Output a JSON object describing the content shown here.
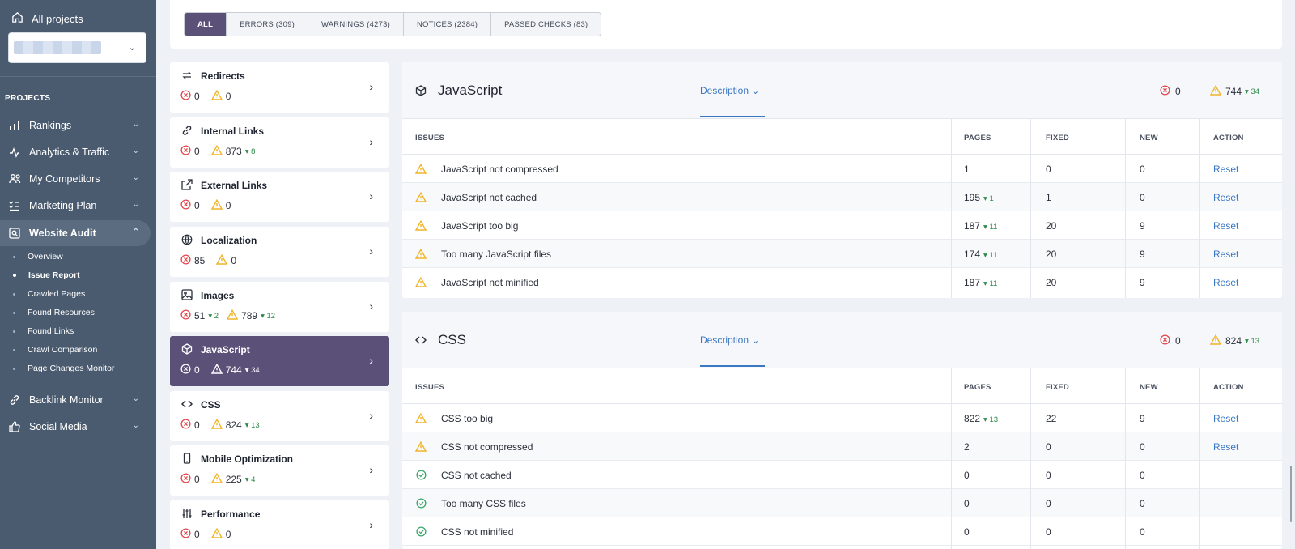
{
  "sidebar": {
    "all_projects": "All projects",
    "projects_heading": "PROJECTS",
    "items": [
      {
        "label": "Rankings",
        "icon": "bar-chart-icon"
      },
      {
        "label": "Analytics & Traffic",
        "icon": "pulse-icon"
      },
      {
        "label": "My Competitors",
        "icon": "users-icon"
      },
      {
        "label": "Marketing Plan",
        "icon": "checklist-icon"
      },
      {
        "label": "Website Audit",
        "icon": "audit-icon"
      },
      {
        "label": "Backlink Monitor",
        "icon": "link-icon"
      },
      {
        "label": "Social Media",
        "icon": "thumbs-up-icon"
      }
    ],
    "subitems": [
      "Overview",
      "Issue Report",
      "Crawled Pages",
      "Found Resources",
      "Found Links",
      "Crawl Comparison",
      "Page Changes Monitor"
    ]
  },
  "filters": {
    "all": "ALL",
    "errors": "ERRORS (309)",
    "warnings": "WARNINGS (4273)",
    "notices": "NOTICES (2384)",
    "passed": "PASSED CHECKS (83)"
  },
  "categories": [
    {
      "title": "Redirects",
      "errors": "0",
      "warnings": "0",
      "err_delta": "",
      "warn_delta": ""
    },
    {
      "title": "Internal Links",
      "errors": "0",
      "warnings": "873",
      "err_delta": "",
      "warn_delta": "▾ 8"
    },
    {
      "title": "External Links",
      "errors": "0",
      "warnings": "0",
      "err_delta": "",
      "warn_delta": ""
    },
    {
      "title": "Localization",
      "errors": "85",
      "warnings": "0",
      "err_delta": "",
      "warn_delta": ""
    },
    {
      "title": "Images",
      "errors": "51",
      "warnings": "789",
      "err_delta": "▾ 2",
      "warn_delta": "▾ 12"
    },
    {
      "title": "JavaScript",
      "errors": "0",
      "warnings": "744",
      "err_delta": "",
      "warn_delta": "▾ 34"
    },
    {
      "title": "CSS",
      "errors": "0",
      "warnings": "824",
      "err_delta": "",
      "warn_delta": "▾ 13"
    },
    {
      "title": "Mobile Optimization",
      "errors": "0",
      "warnings": "225",
      "err_delta": "",
      "warn_delta": "▾ 4"
    },
    {
      "title": "Performance",
      "errors": "0",
      "warnings": "0",
      "err_delta": "",
      "warn_delta": ""
    }
  ],
  "columns": {
    "issues": "ISSUES",
    "pages": "PAGES",
    "fixed": "FIXED",
    "new": "NEW",
    "action": "ACTION"
  },
  "js_section": {
    "title": "JavaScript",
    "description": "Description",
    "errors": "0",
    "warnings": "744",
    "warn_delta": "▾ 34",
    "rows": [
      {
        "status": "warning",
        "issue": "JavaScript not compressed",
        "pages": "1",
        "pages_delta": "",
        "fixed": "0",
        "new": "0",
        "action": "Reset"
      },
      {
        "status": "warning",
        "issue": "JavaScript not cached",
        "pages": "195",
        "pages_delta": "▾ 1",
        "fixed": "1",
        "new": "0",
        "action": "Reset"
      },
      {
        "status": "warning",
        "issue": "JavaScript too big",
        "pages": "187",
        "pages_delta": "▾ 11",
        "fixed": "20",
        "new": "9",
        "action": "Reset"
      },
      {
        "status": "warning",
        "issue": "Too many JavaScript files",
        "pages": "174",
        "pages_delta": "▾ 11",
        "fixed": "20",
        "new": "9",
        "action": "Reset"
      },
      {
        "status": "warning",
        "issue": "JavaScript not minified",
        "pages": "187",
        "pages_delta": "▾ 11",
        "fixed": "20",
        "new": "9",
        "action": "Reset"
      }
    ]
  },
  "css_section": {
    "title": "CSS",
    "description": "Description",
    "errors": "0",
    "warnings": "824",
    "warn_delta": "▾ 13",
    "rows": [
      {
        "status": "warning",
        "issue": "CSS too big",
        "pages": "822",
        "pages_delta": "▾ 13",
        "fixed": "22",
        "new": "9",
        "action": "Reset"
      },
      {
        "status": "warning",
        "issue": "CSS not compressed",
        "pages": "2",
        "pages_delta": "",
        "fixed": "0",
        "new": "0",
        "action": "Reset"
      },
      {
        "status": "passed",
        "issue": "CSS not cached",
        "pages": "0",
        "pages_delta": "",
        "fixed": "0",
        "new": "0",
        "action": ""
      },
      {
        "status": "passed",
        "issue": "Too many CSS files",
        "pages": "0",
        "pages_delta": "",
        "fixed": "0",
        "new": "0",
        "action": ""
      },
      {
        "status": "passed",
        "issue": "CSS not minified",
        "pages": "0",
        "pages_delta": "",
        "fixed": "0",
        "new": "0",
        "action": ""
      }
    ]
  },
  "colors": {
    "accent": "#5a5078",
    "sidebar": "#4a5b70",
    "link": "#3b78c2",
    "error": "#e0474c",
    "warning": "#f0b429",
    "passed": "#3aa56a"
  }
}
